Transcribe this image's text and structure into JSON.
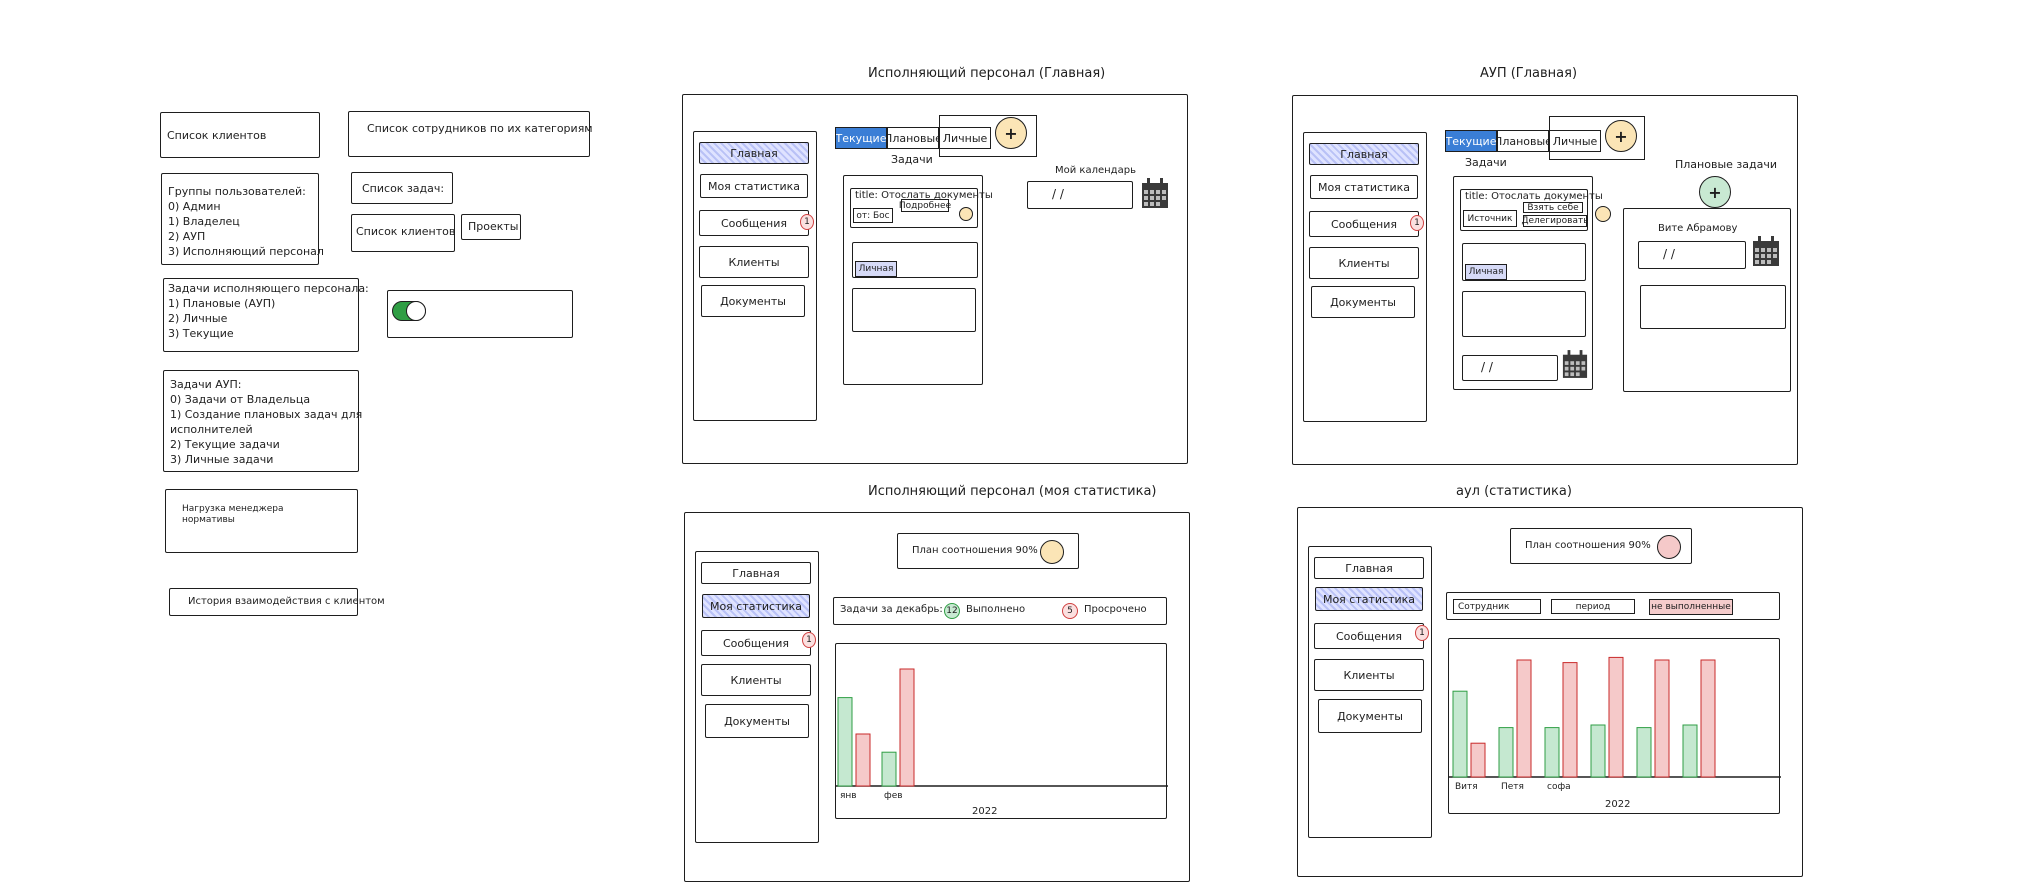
{
  "colors": {
    "accent_blue": "#3a7ed6",
    "nav_active": "#c2c9f7",
    "bar_green": "#c5e8d0",
    "bar_red": "#f5c9c9",
    "plus_yellow": "#fbe5b6",
    "plus_green": "#c8e9d2",
    "badge_red": "#fbe0e0"
  },
  "left": {
    "clients": "Список клиентов",
    "staff_by_cat": "Список сотрудников по их категориям",
    "groups": "Группы пользователей:\n0) Админ\n1) Владелец\n2) АУП\n3) Исполняющий персонал",
    "task_list": "Список задач:",
    "clients2": "Список клиентов",
    "projects": "Проекты",
    "exec_tasks": "Задачи исполняющего персонала:\n1) Плановые (АУП)\n2) Личные\n3) Текущие",
    "aup_tasks": "Задачи АУП:\n0) Задачи от Владельца\n1) Создание плановых задач для\nисполнителей\n2) Текущие задачи\n3) Личные задачи",
    "load": "Нагрузка менеджера\nнормативы",
    "history": "История взаимодействия с клиентом"
  },
  "nav": {
    "home": "Главная",
    "stats": "Моя статистика",
    "messages": "Сообщения",
    "clients": "Клиенты",
    "docs": "Документы",
    "badge": "1"
  },
  "tabs": {
    "current": "Текущие",
    "planned": "Плановые",
    "personal": "Личные",
    "plus": "+"
  },
  "f1": {
    "title": "Исполняющий персонал (Главная)",
    "tasks": "Задачи",
    "task_title": "title: Отослать документы",
    "from": "от: Бос",
    "details": "Подробнее",
    "personal": "Личная",
    "calendar": "Мой календарь",
    "date": "/  /"
  },
  "f2": {
    "title": "АУП (Главная)",
    "tasks": "Задачи",
    "task_title": "title: Отослать документы",
    "source": "Источник",
    "take": "Взять себе",
    "delegate": "Делегировать",
    "personal": "Личная",
    "date": "/  /",
    "planned": "Плановые задачи",
    "assignee": "Вите Абрамову",
    "date2": "/  /"
  },
  "f3": {
    "title": "Исполняющий персонал (моя статистика)",
    "plan": "План соотношения 90%",
    "tasks_dec": "Задачи за декабрь:",
    "done_n": "12",
    "done": "Выполнено",
    "late_n": "5",
    "late": "Просрочено",
    "year": "2022"
  },
  "f4": {
    "title": "аул (статистика)",
    "plan": "План соотношения 90%",
    "employee": "Сотрудник",
    "period": "период",
    "not_done": "не выполненные",
    "year": "2022"
  },
  "chart_data": [
    {
      "type": "bar",
      "categories": [
        "янв",
        "фев"
      ],
      "series": [
        {
          "values": [
            34,
            13
          ]
        },
        {
          "values": [
            20,
            45
          ]
        }
      ],
      "ylim": [
        0,
        50
      ],
      "xlabel": "2022",
      "ylabel": "",
      "grid": false
    },
    {
      "type": "bar",
      "categories": [
        "Витя",
        "Петя",
        "софа",
        "",
        "",
        ""
      ],
      "series": [
        {
          "values": [
            33,
            19,
            19,
            20,
            19,
            20
          ]
        },
        {
          "values": [
            13,
            45,
            44,
            46,
            45,
            45
          ]
        }
      ],
      "ylim": [
        0,
        50
      ],
      "xlabel": "2022",
      "ylabel": "",
      "grid": false
    }
  ]
}
